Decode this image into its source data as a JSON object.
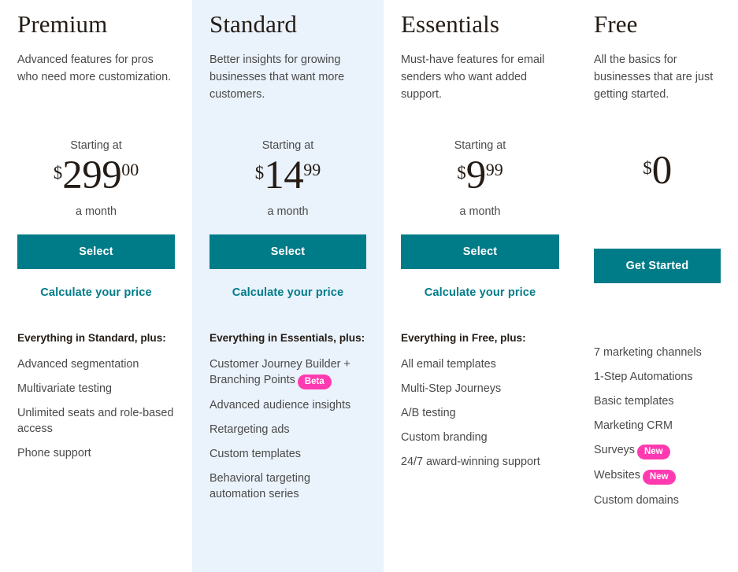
{
  "theme": {
    "accent_teal": "#007C89",
    "highlight_bg": "#EAF2FB",
    "badge_pink": "#FF3AB0",
    "heading_color": "#241C15",
    "body_text": "#4A4A4A"
  },
  "plans": [
    {
      "name": "Premium",
      "tagline": "Advanced features for pros who need more customization.",
      "price_prefix": "Starting at",
      "currency": "$",
      "amount": "299",
      "cents": "00",
      "price_suffix": "a month",
      "cta_label": "Select",
      "calc_link": "Calculate your price",
      "features_lead": "Everything in Standard, plus:",
      "features": [
        {
          "text": "Advanced segmentation",
          "badge": ""
        },
        {
          "text": "Multivariate testing",
          "badge": ""
        },
        {
          "text": "Unlimited seats and role-based access",
          "badge": ""
        },
        {
          "text": "Phone support",
          "badge": ""
        }
      ]
    },
    {
      "name": "Standard",
      "tagline": "Better insights for growing businesses that want more customers.",
      "price_prefix": "Starting at",
      "currency": "$",
      "amount": "14",
      "cents": "99",
      "price_suffix": "a month",
      "cta_label": "Select",
      "calc_link": "Calculate your price",
      "features_lead": "Everything in Essentials, plus:",
      "features": [
        {
          "text": "Customer Journey Builder + Branching Points",
          "badge": "Beta"
        },
        {
          "text": "Advanced audience insights",
          "badge": ""
        },
        {
          "text": "Retargeting ads",
          "badge": ""
        },
        {
          "text": "Custom templates",
          "badge": ""
        },
        {
          "text": "Behavioral targeting automation series",
          "badge": ""
        }
      ]
    },
    {
      "name": "Essentials",
      "tagline": "Must-have features for email senders who want added support.",
      "price_prefix": "Starting at",
      "currency": "$",
      "amount": "9",
      "cents": "99",
      "price_suffix": "a month",
      "cta_label": "Select",
      "calc_link": "Calculate your price",
      "features_lead": "Everything in Free, plus:",
      "features": [
        {
          "text": "All email templates",
          "badge": ""
        },
        {
          "text": "Multi-Step Journeys",
          "badge": ""
        },
        {
          "text": "A/B testing",
          "badge": ""
        },
        {
          "text": "Custom branding",
          "badge": ""
        },
        {
          "text": "24/7 award-winning support",
          "badge": ""
        }
      ]
    },
    {
      "name": "Free",
      "tagline": "All the basics for businesses that are just getting started.",
      "price_prefix": "",
      "currency": "$",
      "amount": "0",
      "cents": "",
      "price_suffix": "",
      "cta_label": "Get Started",
      "calc_link": "",
      "features_lead": "",
      "features": [
        {
          "text": "7 marketing channels",
          "badge": ""
        },
        {
          "text": "1-Step Automations",
          "badge": ""
        },
        {
          "text": "Basic templates",
          "badge": ""
        },
        {
          "text": "Marketing CRM",
          "badge": ""
        },
        {
          "text": "Surveys",
          "badge": "New"
        },
        {
          "text": "Websites",
          "badge": "New"
        },
        {
          "text": "Custom domains",
          "badge": ""
        }
      ]
    }
  ]
}
